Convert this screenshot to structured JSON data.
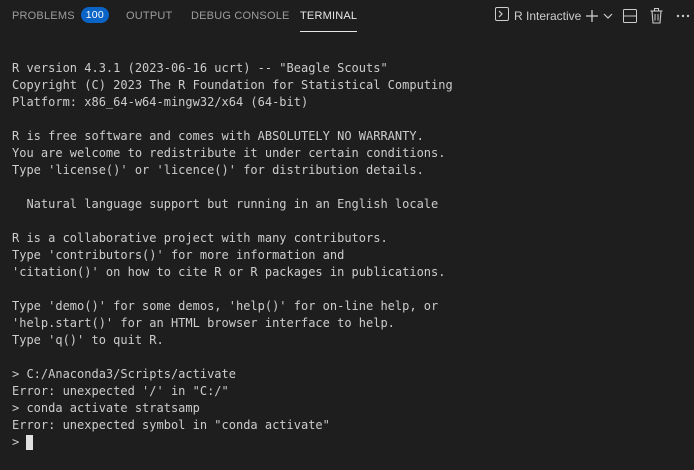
{
  "panel": {
    "tabs": [
      {
        "label": "PROBLEMS",
        "badge": "100"
      },
      {
        "label": "OUTPUT"
      },
      {
        "label": "DEBUG CONSOLE"
      },
      {
        "label": "TERMINAL",
        "active": true
      }
    ],
    "terminal_profile": "R Interactive",
    "icons": [
      "terminal-icon",
      "plus-icon",
      "chevron-down-icon",
      "split-icon",
      "trash-icon",
      "more-icon"
    ]
  },
  "terminal": {
    "lines": [
      "R version 4.3.1 (2023-06-16 ucrt) -- \"Beagle Scouts\"",
      "Copyright (C) 2023 The R Foundation for Statistical Computing",
      "Platform: x86_64-w64-mingw32/x64 (64-bit)",
      "",
      "R is free software and comes with ABSOLUTELY NO WARRANTY.",
      "You are welcome to redistribute it under certain conditions.",
      "Type 'license()' or 'licence()' for distribution details.",
      "",
      "  Natural language support but running in an English locale",
      "",
      "R is a collaborative project with many contributors.",
      "Type 'contributors()' for more information and",
      "'citation()' on how to cite R or R packages in publications.",
      "",
      "Type 'demo()' for some demos, 'help()' for on-line help, or",
      "'help.start()' for an HTML browser interface to help.",
      "Type 'q()' to quit R.",
      "",
      "> C:/Anaconda3/Scripts/activate",
      "Error: unexpected '/' in \"C:/\"",
      "> conda activate stratsamp",
      "Error: unexpected symbol in \"conda activate\""
    ],
    "prompt": ">"
  },
  "colors": {
    "background": "#1e1e1e",
    "text": "#cccccc",
    "badge": "#0a64c6"
  }
}
